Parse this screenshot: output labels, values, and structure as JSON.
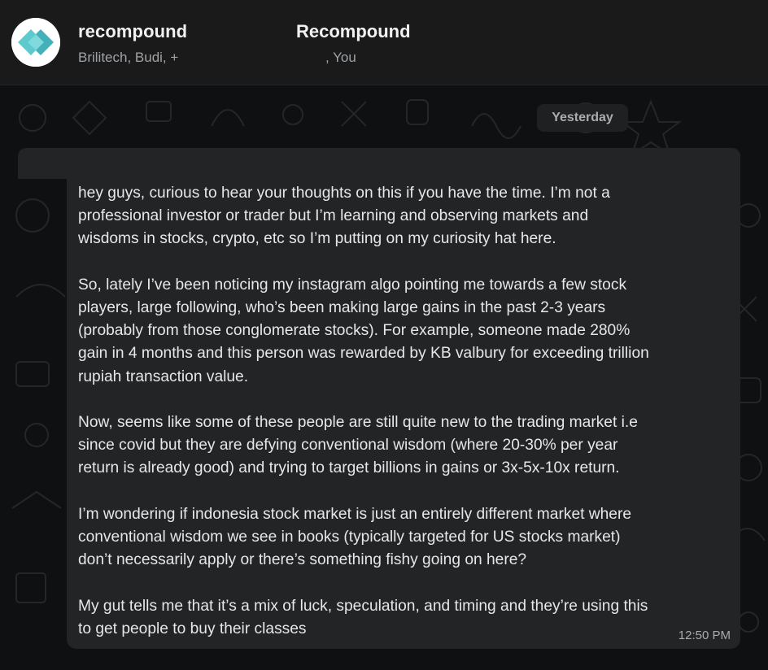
{
  "header": {
    "group_name_part1": "recompound",
    "group_name_part2": "Recompound",
    "members_part1": "Brilitech, Budi, +",
    "members_part2": ", You",
    "avatar_icon": "diamond-logo-icon"
  },
  "chat": {
    "date_label": "Yesterday",
    "message": {
      "paragraphs": [
        "hey guys, curious to hear your thoughts on this if you have the time. I’m not a\nprofessional investor or trader but I’m learning and observing markets and\nwisdoms in stocks, crypto, etc so I’m putting on my curiosity hat here.",
        "So, lately I’ve been noticing my instagram algo pointing me towards a few stock\nplayers, large following, who’s been making large gains in the past 2-3 years\n(probably from those conglomerate stocks). For example, someone made 280%\ngain in 4 months and this person was rewarded by KB valbury for exceeding trillion\nrupiah transaction value.",
        "Now, seems like some of these people are still quite new to the trading market i.e\nsince covid but they are defying conventional wisdom (where 20-30% per year\nreturn is already good) and trying to target billions in gains or 3x-5x-10x return.",
        "I’m wondering if indonesia stock market is just an entirely different market where\nconventional wisdom we see in books (typically targeted for US stocks market)\ndon’t necessarily apply or there’s something fishy going on here?",
        "My gut tells me that it’s a mix of luck, speculation, and timing and they’re using this\nto get people to buy their classes"
      ],
      "time": "12:50 PM"
    }
  },
  "colors": {
    "background": "#0f1011",
    "header": "#1a1a1b",
    "bubble": "#232425",
    "logo_teal": "#5ecad0",
    "logo_teal_dark": "#2fa8b3"
  }
}
